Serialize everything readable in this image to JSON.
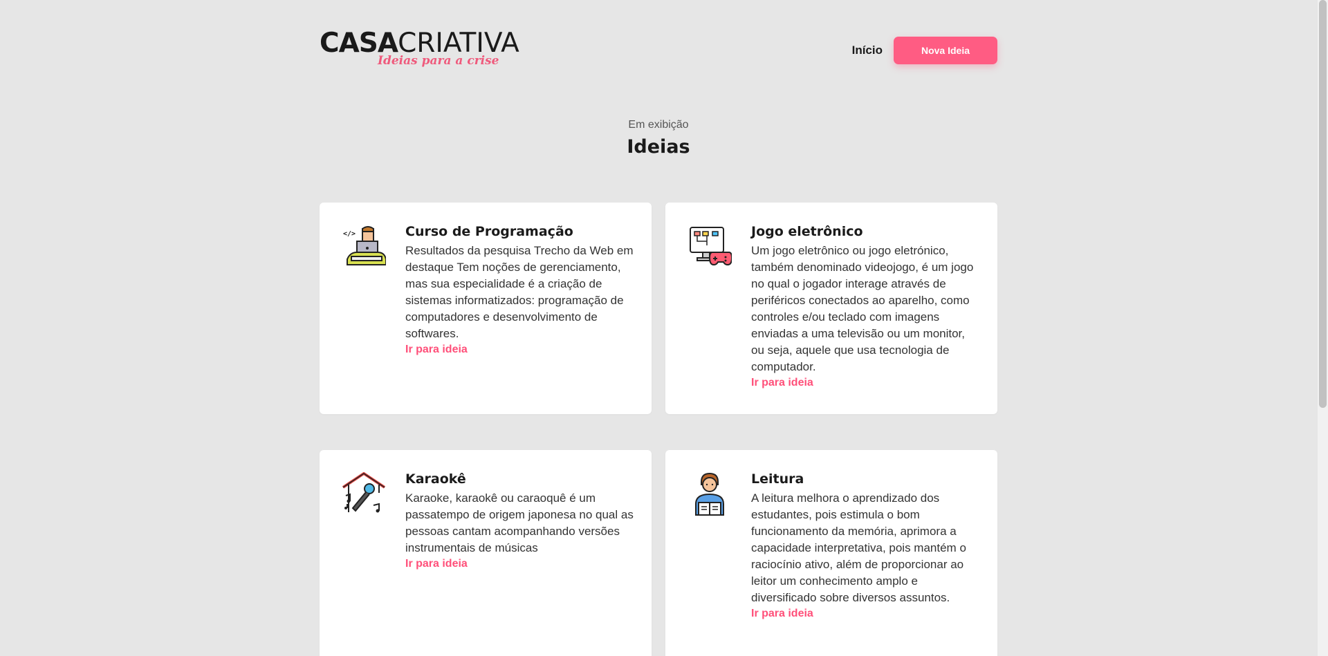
{
  "header": {
    "logo_bold": "CASA",
    "logo_light": "CRIATIVA",
    "logo_tagline": "Ideias para a crise",
    "nav_home": "Início",
    "nav_new_idea": "Nova Ideia"
  },
  "section": {
    "subtitle": "Em exibição",
    "title": "Ideias"
  },
  "ideas": [
    {
      "icon": "programmer-laptop-icon",
      "title": "Curso de Programação",
      "description": "Resultados da pesquisa Trecho da Web em destaque Tem noções de gerenciamento, mas sua especialidade é a criação de sistemas informatizados: programação de computadores e desenvolvimento de softwares.",
      "link": "Ir para ideia"
    },
    {
      "icon": "monitor-gamepad-icon",
      "title": "Jogo eletrônico",
      "description": "Um jogo eletrônico ou jogo eletrónico, também denominado videojogo, é um jogo no qual o jogador interage através de periféricos conectados ao aparelho, como controles e/ou teclado com imagens enviadas a uma televisão ou um monitor, ou seja, aquele que usa tecnologia de computador.",
      "link": "Ir para ideia"
    },
    {
      "icon": "karaoke-microphone-icon",
      "title": "Karaokê",
      "description": "Karaoke, karaokê ou caraoquê é um passatempo de origem japonesa no qual as pessoas cantam acompanhando versões instrumentais de músicas",
      "link": "Ir para ideia"
    },
    {
      "icon": "reading-person-icon",
      "title": "Leitura",
      "description": "A leitura melhora o aprendizado dos estudantes, pois estimula o bom funcionamento da memória, aprimora a capacidade interpretativa, pois mantém o raciocínio ativo, além de proporcionar ao leitor um conhecimento amplo e diversificado sobre diversos assuntos.",
      "link": "Ir para ideia"
    }
  ],
  "colors": {
    "accent": "#ff5c83",
    "background": "#e6e6e6",
    "card": "#ffffff"
  }
}
